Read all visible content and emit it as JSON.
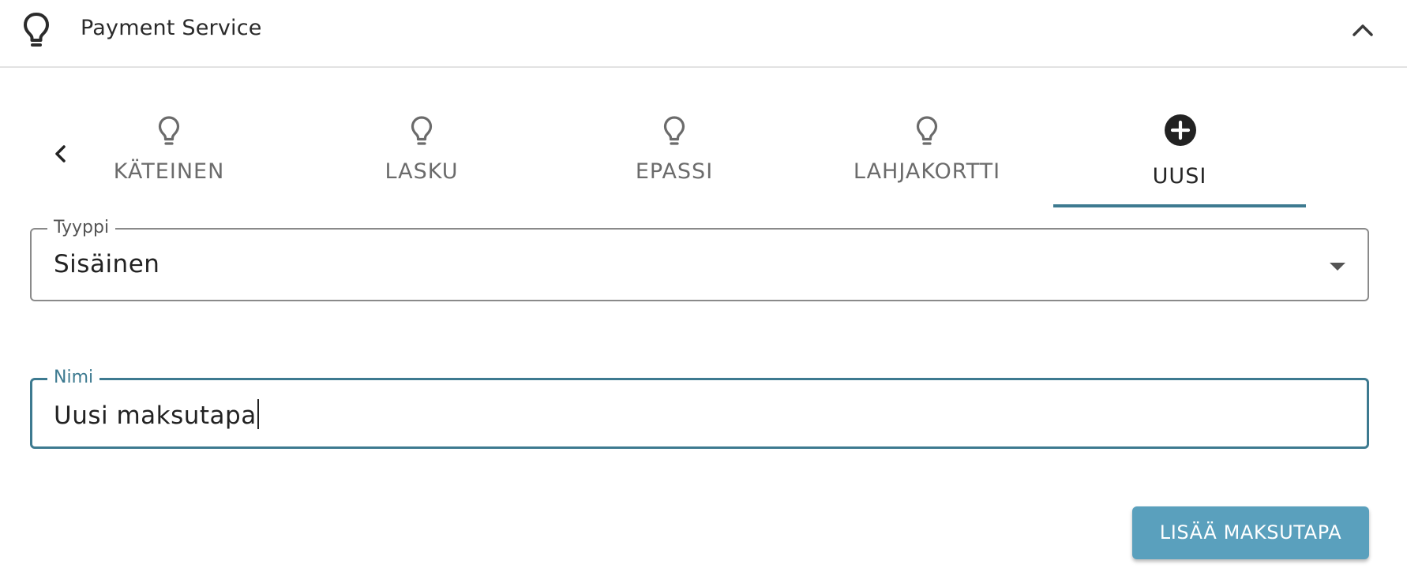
{
  "header": {
    "title": "Payment Service",
    "icon": "lightbulb-icon",
    "collapse_icon": "chevron-up-icon"
  },
  "tabs": {
    "prev_icon": "chevron-left-icon",
    "items": [
      {
        "label": "KÄTEINEN",
        "icon": "lightbulb-icon",
        "active": false
      },
      {
        "label": "LASKU",
        "icon": "lightbulb-icon",
        "active": false
      },
      {
        "label": "EPASSI",
        "icon": "lightbulb-icon",
        "active": false
      },
      {
        "label": "LAHJAKORTTI",
        "icon": "lightbulb-icon",
        "active": false
      },
      {
        "label": "UUSI",
        "icon": "add-circle-icon",
        "active": true
      }
    ]
  },
  "form": {
    "type_field": {
      "label": "Tyyppi",
      "value": "Sisäinen"
    },
    "name_field": {
      "label": "Nimi",
      "value": "Uusi maksutapa"
    },
    "submit_label": "LISÄÄ MAKSUTAPA"
  },
  "colors": {
    "accent": "#3d7a90",
    "button": "#5aa0bd",
    "tab_inactive": "#6b6b6b"
  }
}
